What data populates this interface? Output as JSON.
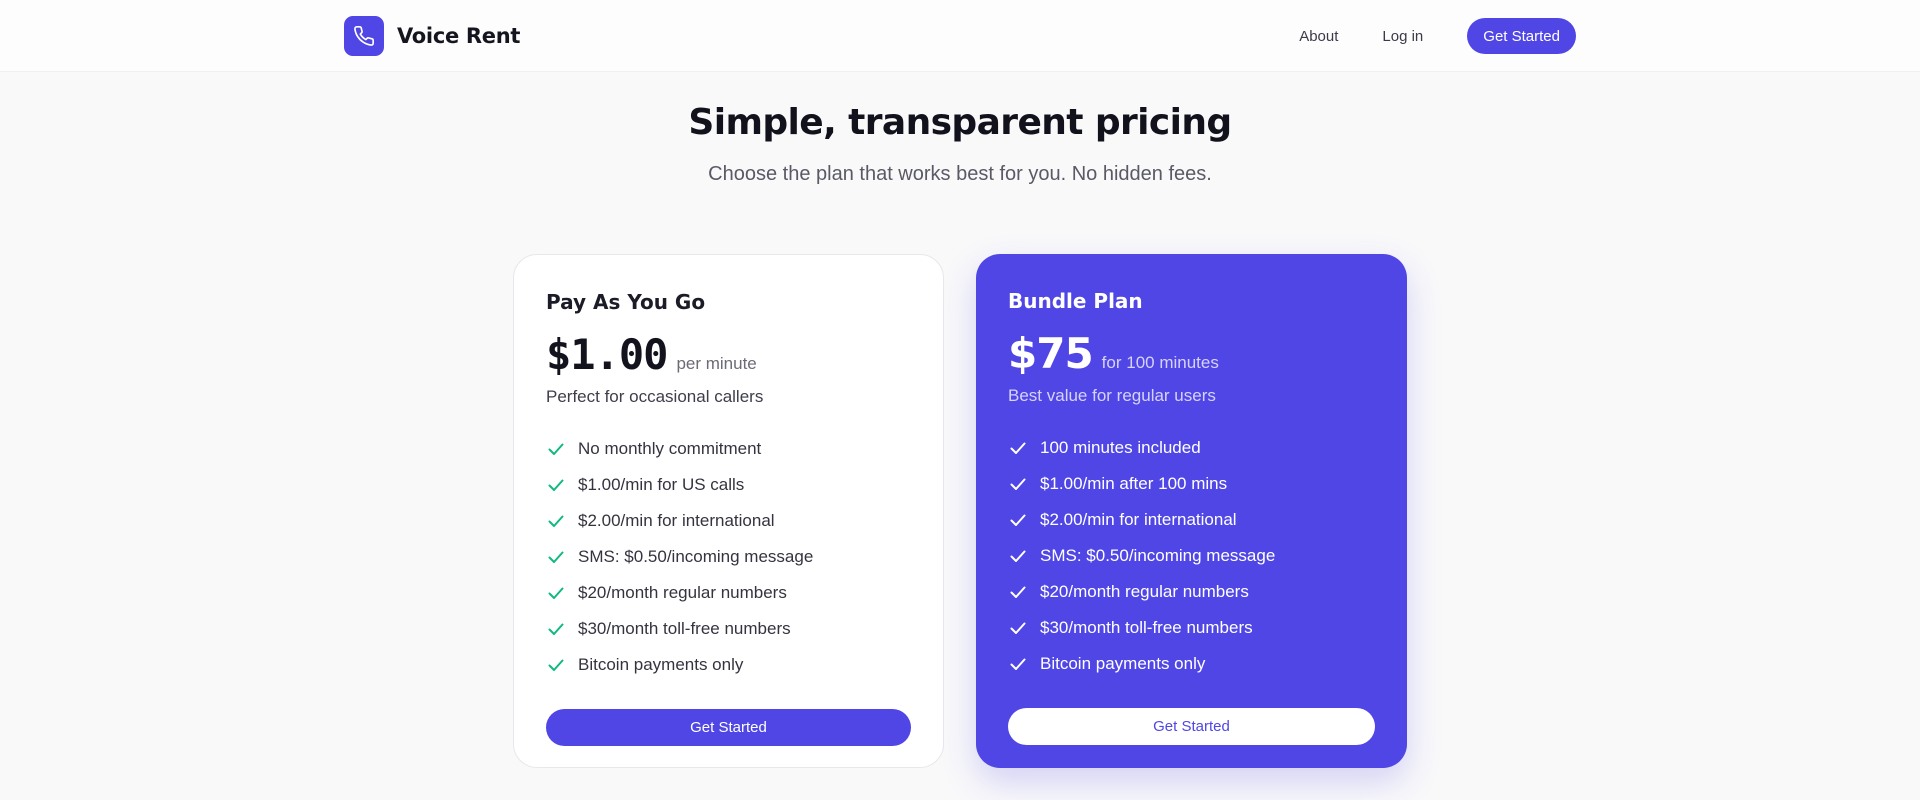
{
  "brand": {
    "name": "Voice Rent",
    "logo_icon": "phone-icon"
  },
  "nav": {
    "about": "About",
    "login": "Log in",
    "cta": "Get Started"
  },
  "hero": {
    "title": "Simple, transparent pricing",
    "subtitle": "Choose the plan that works best for you. No hidden fees."
  },
  "colors": {
    "accent": "#4f46e5",
    "check_green": "#10b981"
  },
  "plans": [
    {
      "name": "Pay As You Go",
      "price": "$1.00",
      "unit": "per minute",
      "tagline": "Perfect for occasional callers",
      "features": [
        "No monthly commitment",
        "$1.00/min for US calls",
        "$2.00/min for international",
        "SMS: $0.50/incoming message",
        "$20/month regular numbers",
        "$30/month toll-free numbers",
        "Bitcoin payments only"
      ],
      "cta": "Get Started"
    },
    {
      "name": "Bundle Plan",
      "price": "$75",
      "unit": "for 100 minutes",
      "tagline": "Best value for regular users",
      "features": [
        "100 minutes included",
        "$1.00/min after 100 mins",
        "$2.00/min for international",
        "SMS: $0.50/incoming message",
        "$20/month regular numbers",
        "$30/month toll-free numbers",
        "Bitcoin payments only"
      ],
      "cta": "Get Started"
    }
  ]
}
